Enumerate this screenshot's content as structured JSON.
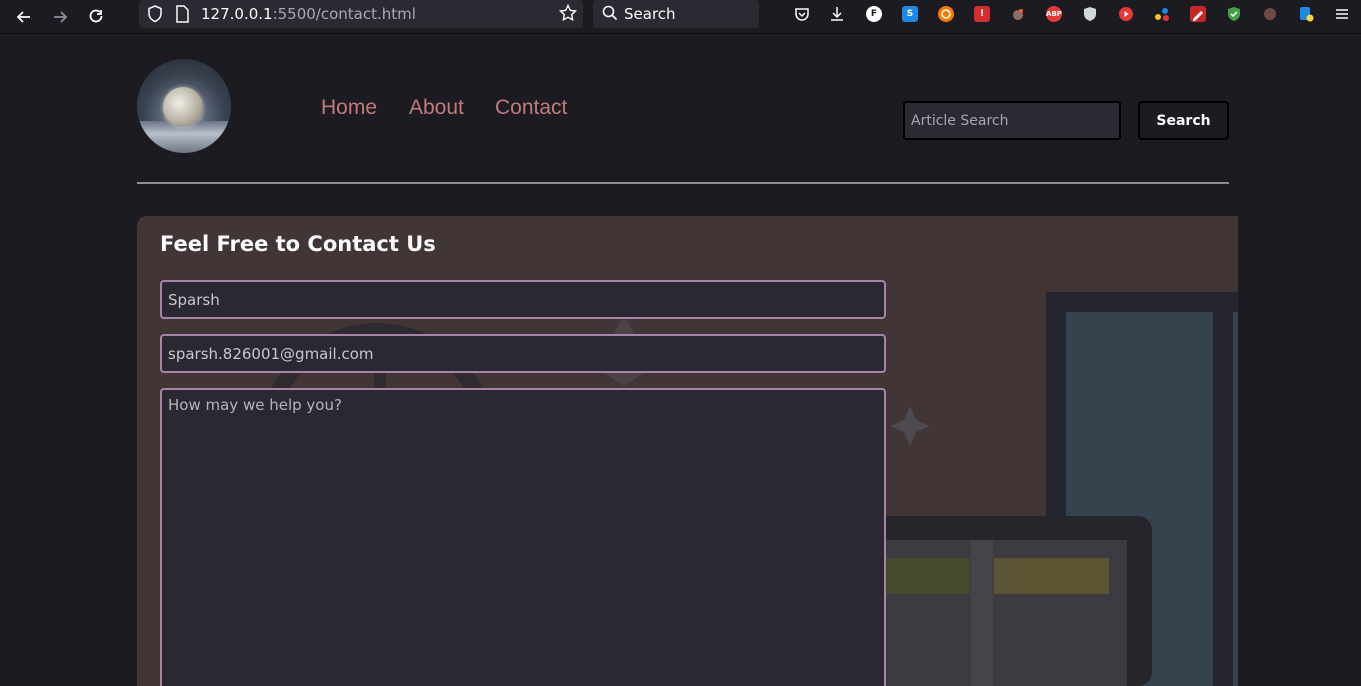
{
  "browser": {
    "url_host": "127.0.0.1",
    "url_path": ":5500/contact.html",
    "search_placeholder": "Search"
  },
  "nav": {
    "items": [
      {
        "label": "Home"
      },
      {
        "label": "About"
      },
      {
        "label": "Contact"
      }
    ]
  },
  "search": {
    "placeholder": "Article Search",
    "button_label": "Search"
  },
  "contact": {
    "title": "Feel Free to Contact Us",
    "name_value": "Sparsh",
    "email_value": "sparsh.826001@gmail.com",
    "message_placeholder": "How may we help you?"
  },
  "colors": {
    "background": "#1c1b22",
    "nav_link": "#c27a7c",
    "card": "#413536",
    "field_border": "#a884a8"
  },
  "icons": [
    "back-arrow-icon",
    "forward-arrow-icon",
    "reload-icon",
    "shield-icon",
    "page-icon",
    "bookmark-star-icon",
    "search-icon",
    "pocket-icon",
    "download-icon",
    "menu-icon"
  ]
}
